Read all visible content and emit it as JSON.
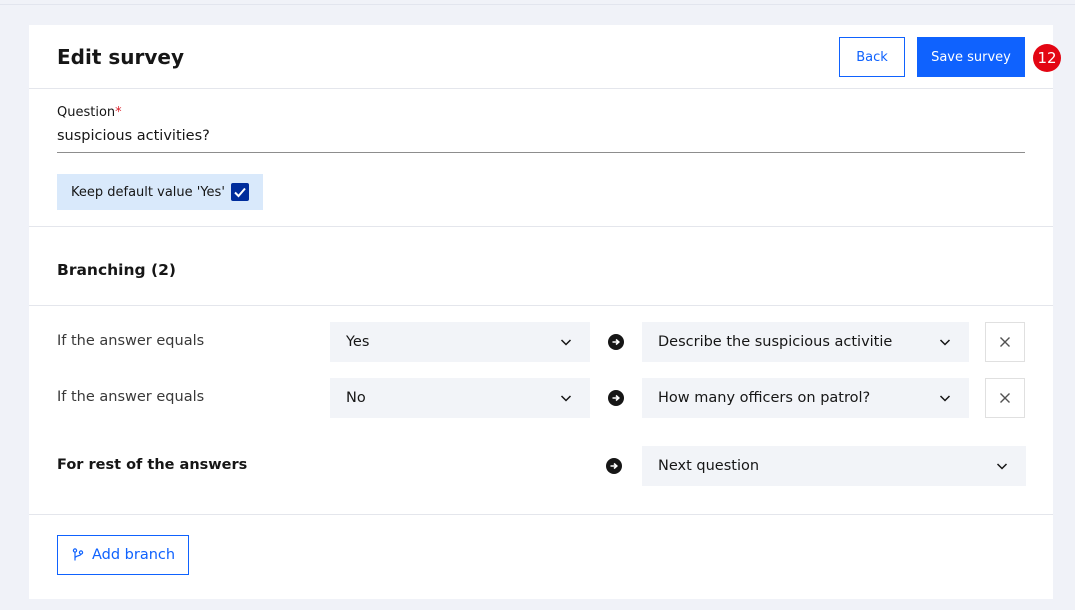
{
  "header": {
    "title": "Edit survey",
    "back_label": "Back",
    "save_label": "Save survey",
    "badge_count": "12"
  },
  "question": {
    "label": "Question",
    "required_mark": "*",
    "value": "suspicious activities?",
    "keep_default_label": "Keep default value 'Yes'",
    "keep_default_checked": true
  },
  "branching": {
    "title": "Branching (2)",
    "rows": [
      {
        "condition_label": "If the answer equals",
        "answer": "Yes",
        "target": "Describe the suspicious activitie"
      },
      {
        "condition_label": "If the answer equals",
        "answer": "No",
        "target": "How many officers on patrol?"
      }
    ],
    "rest_label": "For rest of the answers",
    "rest_target": "Next question",
    "add_branch_label": "Add branch"
  },
  "colors": {
    "accent": "#0f62fe",
    "badge": "#e30613",
    "checkbox": "#002d9c",
    "highlight_bg": "#d9e9fb"
  }
}
